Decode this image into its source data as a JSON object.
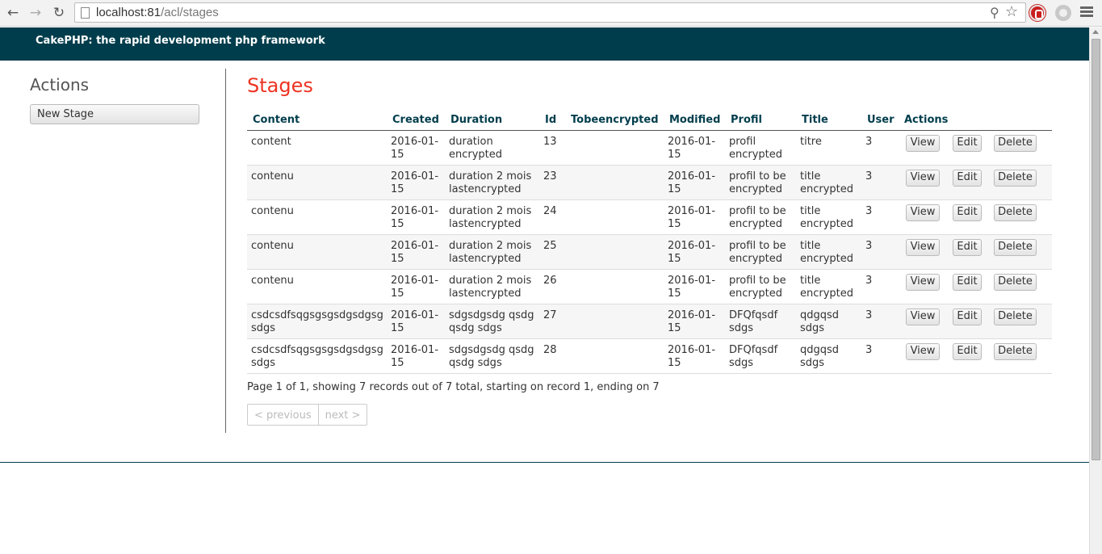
{
  "browser": {
    "url_host": "localhost:81",
    "url_path": "/acl/stages"
  },
  "header": {
    "title": "CakePHP: the rapid development php framework"
  },
  "sidebar": {
    "title": "Actions",
    "new_button": "New Stage"
  },
  "main": {
    "title": "Stages",
    "columns": [
      "Content",
      "Created",
      "Duration",
      "Id",
      "Tobeencrypted",
      "Modified",
      "Profil",
      "Title",
      "User",
      "Actions"
    ],
    "rows": [
      {
        "content": "content",
        "created": "2016-01-15",
        "duration": "duration encrypted",
        "id": "13",
        "tobeencrypted": "",
        "modified": "2016-01-15",
        "profil": "profil encrypted",
        "title": "titre",
        "user": "3"
      },
      {
        "content": "contenu",
        "created": "2016-01-15",
        "duration": "duration 2 mois lastencrypted",
        "id": "23",
        "tobeencrypted": "",
        "modified": "2016-01-15",
        "profil": "profil to be encrypted",
        "title": "title encrypted",
        "user": "3"
      },
      {
        "content": "contenu",
        "created": "2016-01-15",
        "duration": "duration 2 mois lastencrypted",
        "id": "24",
        "tobeencrypted": "",
        "modified": "2016-01-15",
        "profil": "profil to be encrypted",
        "title": "title encrypted",
        "user": "3"
      },
      {
        "content": "contenu",
        "created": "2016-01-15",
        "duration": "duration 2 mois lastencrypted",
        "id": "25",
        "tobeencrypted": "",
        "modified": "2016-01-15",
        "profil": "profil to be encrypted",
        "title": "title encrypted",
        "user": "3"
      },
      {
        "content": "contenu",
        "created": "2016-01-15",
        "duration": "duration 2 mois lastencrypted",
        "id": "26",
        "tobeencrypted": "",
        "modified": "2016-01-15",
        "profil": "profil to be encrypted",
        "title": "title encrypted",
        "user": "3"
      },
      {
        "content": "csdcsdfsqgsgsgsdgsdgsg sdgs",
        "created": "2016-01-15",
        "duration": "sdgsdgsdg qsdg qsdg sdgs",
        "id": "27",
        "tobeencrypted": "",
        "modified": "2016-01-15",
        "profil": "DFQfqsdf sdgs",
        "title": "qdgqsd sdgs",
        "user": "3"
      },
      {
        "content": "csdcsdfsqgsgsgsdgsdgsg sdgs",
        "created": "2016-01-15",
        "duration": "sdgsdgsdg qsdg qsdg sdgs",
        "id": "28",
        "tobeencrypted": "",
        "modified": "2016-01-15",
        "profil": "DFQfqsdf sdgs",
        "title": "qdgqsd sdgs",
        "user": "3"
      }
    ],
    "action_labels": {
      "view": "View",
      "edit": "Edit",
      "delete": "Delete"
    },
    "paging_info": "Page 1 of 1, showing 7 records out of 7 total, starting on record 1, ending on 7",
    "pager": {
      "previous": "< previous",
      "next": "next >"
    }
  },
  "colors": {
    "header_bg": "#003d4c",
    "title_red": "#e32"
  }
}
